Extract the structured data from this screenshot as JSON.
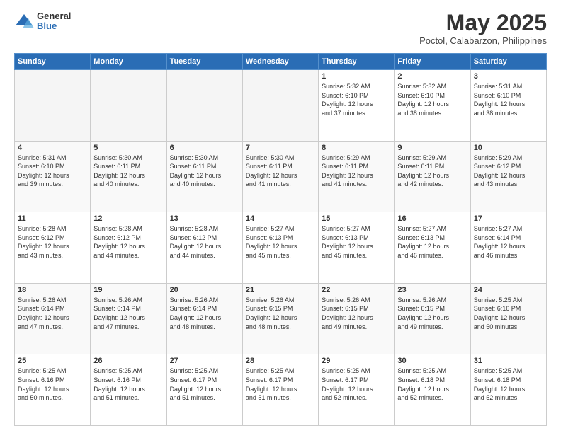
{
  "logo": {
    "general": "General",
    "blue": "Blue"
  },
  "title": "May 2025",
  "subtitle": "Poctol, Calabarzon, Philippines",
  "days": [
    "Sunday",
    "Monday",
    "Tuesday",
    "Wednesday",
    "Thursday",
    "Friday",
    "Saturday"
  ],
  "weeks": [
    [
      {
        "day": "",
        "info": ""
      },
      {
        "day": "",
        "info": ""
      },
      {
        "day": "",
        "info": ""
      },
      {
        "day": "",
        "info": ""
      },
      {
        "day": "1",
        "info": "Sunrise: 5:32 AM\nSunset: 6:10 PM\nDaylight: 12 hours\nand 37 minutes."
      },
      {
        "day": "2",
        "info": "Sunrise: 5:32 AM\nSunset: 6:10 PM\nDaylight: 12 hours\nand 38 minutes."
      },
      {
        "day": "3",
        "info": "Sunrise: 5:31 AM\nSunset: 6:10 PM\nDaylight: 12 hours\nand 38 minutes."
      }
    ],
    [
      {
        "day": "4",
        "info": "Sunrise: 5:31 AM\nSunset: 6:10 PM\nDaylight: 12 hours\nand 39 minutes."
      },
      {
        "day": "5",
        "info": "Sunrise: 5:30 AM\nSunset: 6:11 PM\nDaylight: 12 hours\nand 40 minutes."
      },
      {
        "day": "6",
        "info": "Sunrise: 5:30 AM\nSunset: 6:11 PM\nDaylight: 12 hours\nand 40 minutes."
      },
      {
        "day": "7",
        "info": "Sunrise: 5:30 AM\nSunset: 6:11 PM\nDaylight: 12 hours\nand 41 minutes."
      },
      {
        "day": "8",
        "info": "Sunrise: 5:29 AM\nSunset: 6:11 PM\nDaylight: 12 hours\nand 41 minutes."
      },
      {
        "day": "9",
        "info": "Sunrise: 5:29 AM\nSunset: 6:11 PM\nDaylight: 12 hours\nand 42 minutes."
      },
      {
        "day": "10",
        "info": "Sunrise: 5:29 AM\nSunset: 6:12 PM\nDaylight: 12 hours\nand 43 minutes."
      }
    ],
    [
      {
        "day": "11",
        "info": "Sunrise: 5:28 AM\nSunset: 6:12 PM\nDaylight: 12 hours\nand 43 minutes."
      },
      {
        "day": "12",
        "info": "Sunrise: 5:28 AM\nSunset: 6:12 PM\nDaylight: 12 hours\nand 44 minutes."
      },
      {
        "day": "13",
        "info": "Sunrise: 5:28 AM\nSunset: 6:12 PM\nDaylight: 12 hours\nand 44 minutes."
      },
      {
        "day": "14",
        "info": "Sunrise: 5:27 AM\nSunset: 6:13 PM\nDaylight: 12 hours\nand 45 minutes."
      },
      {
        "day": "15",
        "info": "Sunrise: 5:27 AM\nSunset: 6:13 PM\nDaylight: 12 hours\nand 45 minutes."
      },
      {
        "day": "16",
        "info": "Sunrise: 5:27 AM\nSunset: 6:13 PM\nDaylight: 12 hours\nand 46 minutes."
      },
      {
        "day": "17",
        "info": "Sunrise: 5:27 AM\nSunset: 6:14 PM\nDaylight: 12 hours\nand 46 minutes."
      }
    ],
    [
      {
        "day": "18",
        "info": "Sunrise: 5:26 AM\nSunset: 6:14 PM\nDaylight: 12 hours\nand 47 minutes."
      },
      {
        "day": "19",
        "info": "Sunrise: 5:26 AM\nSunset: 6:14 PM\nDaylight: 12 hours\nand 47 minutes."
      },
      {
        "day": "20",
        "info": "Sunrise: 5:26 AM\nSunset: 6:14 PM\nDaylight: 12 hours\nand 48 minutes."
      },
      {
        "day": "21",
        "info": "Sunrise: 5:26 AM\nSunset: 6:15 PM\nDaylight: 12 hours\nand 48 minutes."
      },
      {
        "day": "22",
        "info": "Sunrise: 5:26 AM\nSunset: 6:15 PM\nDaylight: 12 hours\nand 49 minutes."
      },
      {
        "day": "23",
        "info": "Sunrise: 5:26 AM\nSunset: 6:15 PM\nDaylight: 12 hours\nand 49 minutes."
      },
      {
        "day": "24",
        "info": "Sunrise: 5:25 AM\nSunset: 6:16 PM\nDaylight: 12 hours\nand 50 minutes."
      }
    ],
    [
      {
        "day": "25",
        "info": "Sunrise: 5:25 AM\nSunset: 6:16 PM\nDaylight: 12 hours\nand 50 minutes."
      },
      {
        "day": "26",
        "info": "Sunrise: 5:25 AM\nSunset: 6:16 PM\nDaylight: 12 hours\nand 51 minutes."
      },
      {
        "day": "27",
        "info": "Sunrise: 5:25 AM\nSunset: 6:17 PM\nDaylight: 12 hours\nand 51 minutes."
      },
      {
        "day": "28",
        "info": "Sunrise: 5:25 AM\nSunset: 6:17 PM\nDaylight: 12 hours\nand 51 minutes."
      },
      {
        "day": "29",
        "info": "Sunrise: 5:25 AM\nSunset: 6:17 PM\nDaylight: 12 hours\nand 52 minutes."
      },
      {
        "day": "30",
        "info": "Sunrise: 5:25 AM\nSunset: 6:18 PM\nDaylight: 12 hours\nand 52 minutes."
      },
      {
        "day": "31",
        "info": "Sunrise: 5:25 AM\nSunset: 6:18 PM\nDaylight: 12 hours\nand 52 minutes."
      }
    ]
  ]
}
